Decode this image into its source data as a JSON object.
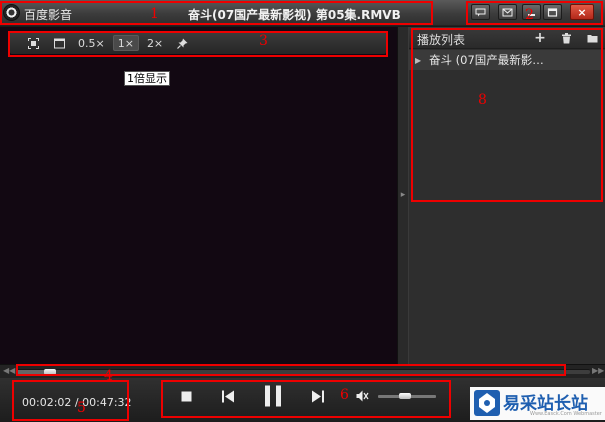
{
  "app": {
    "name": "百度影音",
    "window_title": "奋斗(07国产最新影视) 第05集.RMVB"
  },
  "window_buttons": [
    {
      "icon": "chat-icon"
    },
    {
      "icon": "mail-icon"
    },
    {
      "icon": "minimize-icon"
    },
    {
      "icon": "maximize-icon"
    },
    {
      "icon": "close-icon",
      "label": "×"
    }
  ],
  "video_toolbar": {
    "buttons": [
      {
        "icon": "fullscreen-fit-icon"
      },
      {
        "icon": "window-mode-icon"
      },
      {
        "label": "0.5×"
      },
      {
        "label": "1×",
        "active": true
      },
      {
        "label": "2×"
      },
      {
        "icon": "pin-icon"
      }
    ],
    "tooltip": "1倍显示"
  },
  "playlist": {
    "title": "播放列表",
    "buttons": [
      {
        "label": "+",
        "icon": "add-icon"
      },
      {
        "icon": "trash-icon"
      },
      {
        "icon": "folder-icon"
      }
    ],
    "items": [
      {
        "label": "奋斗 (07国产最新影…",
        "expanded": false
      }
    ]
  },
  "progress": {
    "fraction": 0.05
  },
  "time": {
    "current": "00:02:02",
    "separator": "/",
    "total": "00:47:32"
  },
  "controls": {
    "stop": "stop-icon",
    "previous": "previous-icon",
    "pause": "pause-icon",
    "next": "next-icon",
    "mute": "mute-icon",
    "volume": 0.45
  },
  "watermark": {
    "text": "易采站长站",
    "url": "Www.Easck.Com Webmaster"
  },
  "annotations": [
    "1",
    "2",
    "3",
    "4",
    "5",
    "6",
    "8"
  ],
  "colors": {
    "annotation": "#e00000",
    "close_button": "#c8321f",
    "video_background": "#120812",
    "watermark_brand": "#1f5fb0"
  }
}
